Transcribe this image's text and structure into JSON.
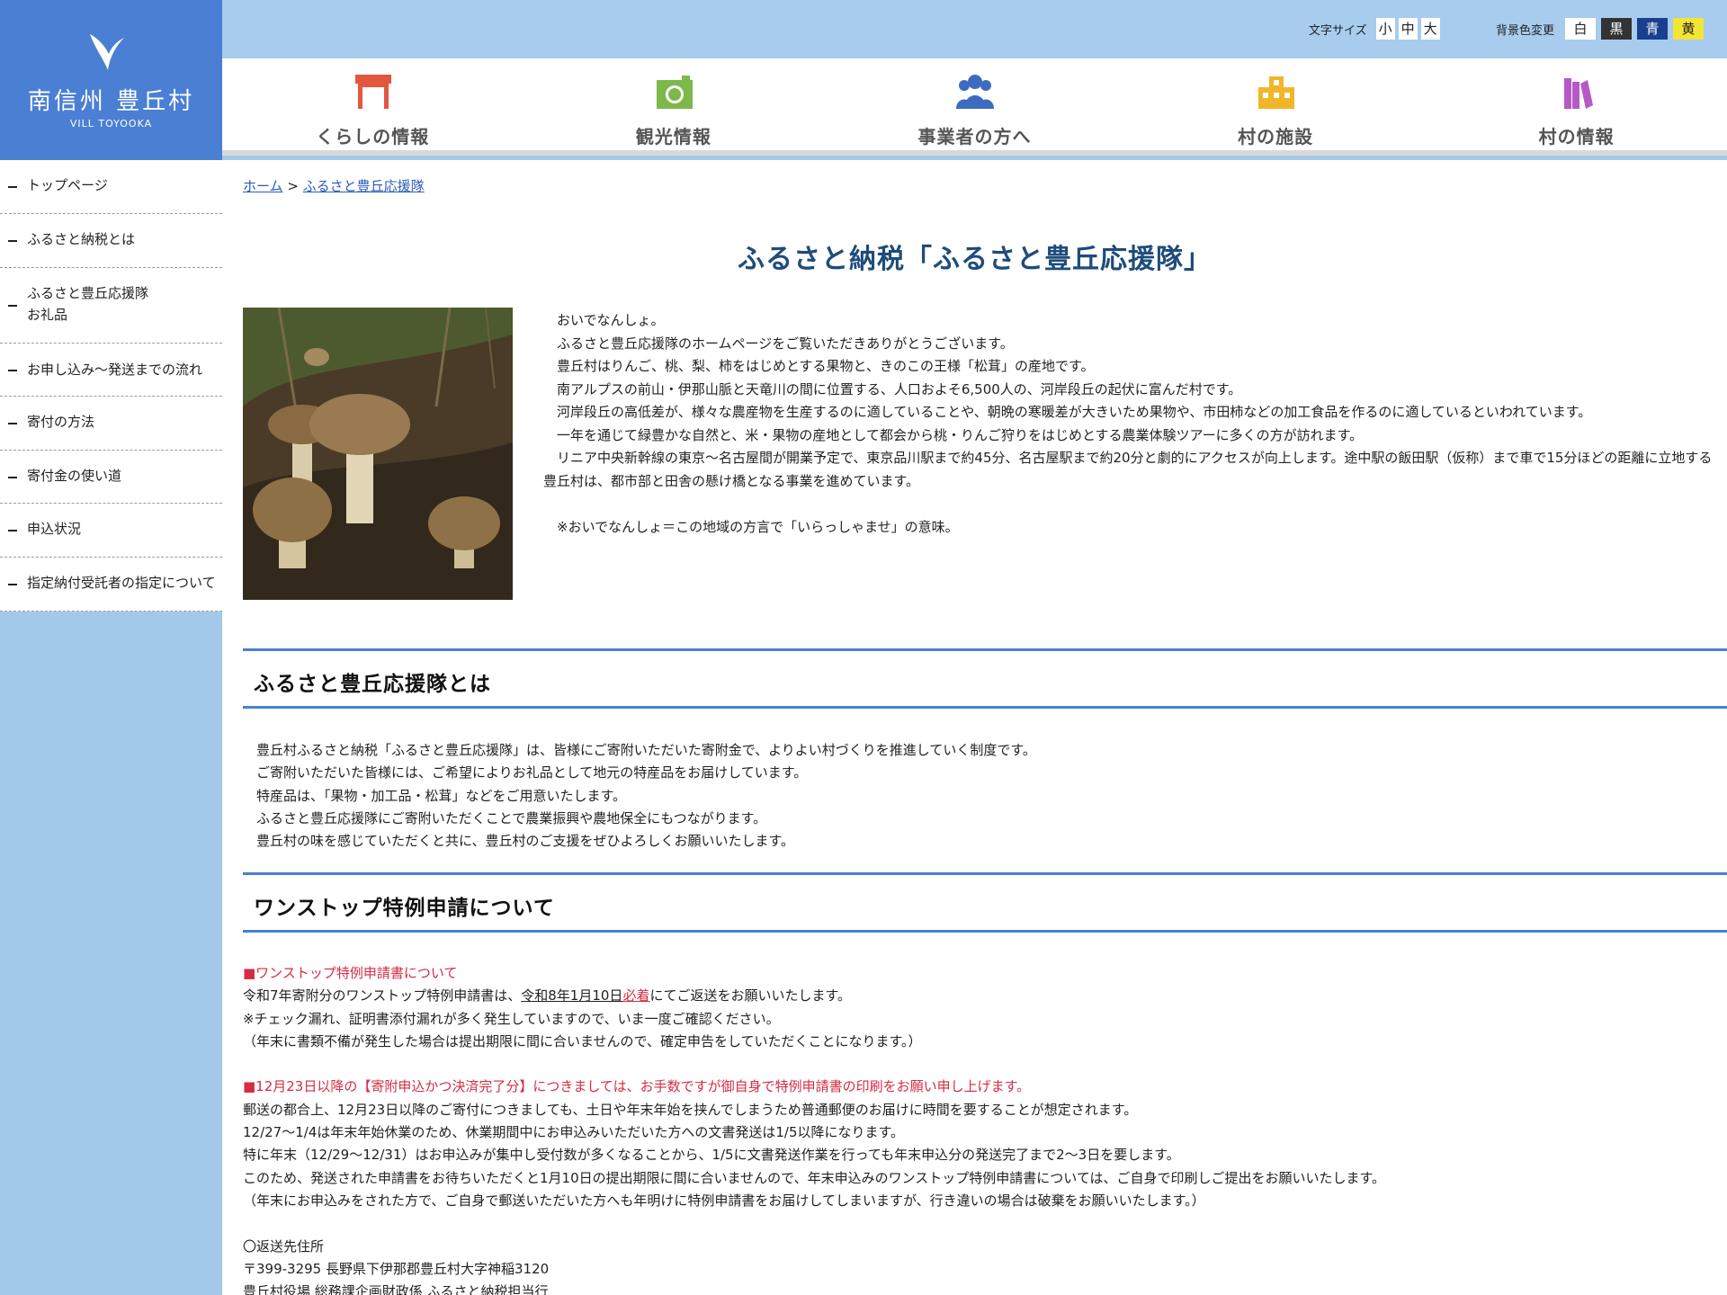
{
  "logo": {
    "name": "南信州 豊丘村",
    "sub": "VILL TOYOOKA"
  },
  "topbar": {
    "fontsize_label": "文字サイズ",
    "fontsize_options": [
      "小",
      "中",
      "大"
    ],
    "bgcolor_label": "背景色変更",
    "bgcolor_options": [
      {
        "label": "白",
        "bg": "#ffffff",
        "fg": "#222222"
      },
      {
        "label": "黒",
        "bg": "#333333",
        "fg": "#ffffff"
      },
      {
        "label": "青",
        "bg": "#1a3f8f",
        "fg": "#ffffff"
      },
      {
        "label": "黄",
        "bg": "#f3e533",
        "fg": "#222222"
      }
    ]
  },
  "nav": [
    {
      "label": "くらしの情報",
      "icon": "house-icon",
      "color": "#e2573e"
    },
    {
      "label": "観光情報",
      "icon": "camera-icon",
      "color": "#7cb84a"
    },
    {
      "label": "事業者の方へ",
      "icon": "people-icon",
      "color": "#3d6cbf"
    },
    {
      "label": "村の施設",
      "icon": "building-icon",
      "color": "#f0b62a"
    },
    {
      "label": "村の情報",
      "icon": "books-icon",
      "color": "#b659c7"
    }
  ],
  "sidebar": {
    "items": [
      {
        "label": "トップページ"
      },
      {
        "label": "ふるさと納税とは"
      },
      {
        "label": "ふるさと豊丘応援隊",
        "label2": "お礼品"
      },
      {
        "label": "お申し込み〜発送までの流れ"
      },
      {
        "label": "寄付の方法"
      },
      {
        "label": "寄付金の使い道"
      },
      {
        "label": "申込状況"
      },
      {
        "label": "指定納付受託者の指定について"
      }
    ]
  },
  "breadcrumb": {
    "home": "ホーム",
    "sep": " > ",
    "current": "ふるさと豊丘応援隊"
  },
  "page_title": "ふるさと納税「ふるさと豊丘応援隊」",
  "intro": [
    "おいでなんしょ。",
    "ふるさと豊丘応援隊のホームページをご覧いただきありがとうございます。",
    "豊丘村はりんご、桃、梨、柿をはじめとする果物と、きのこの王様「松茸」の産地です。",
    "南アルプスの前山・伊那山脈と天竜川の間に位置する、人口およそ6,500人の、河岸段丘の起伏に富んだ村です。",
    "河岸段丘の高低差が、様々な農産物を生産するのに適していることや、朝晩の寒暖差が大きいため果物や、市田柿などの加工食品を作るのに適しているといわれています。",
    "一年を通じて緑豊かな自然と、米・果物の産地として都会から桃・りんご狩りをはじめとする農業体験ツアーに多くの方が訪れます。",
    "リニア中央新幹線の東京〜名古屋間が開業予定で、東京品川駅まで約45分、名古屋駅まで約20分と劇的にアクセスが向上します。途中駅の飯田駅（仮称）まで車で15分ほどの距離に立地する豊丘村は、都市部と田舎の懸け橋となる事業を進めています。",
    "",
    "※おいでなんしょ＝この地域の方言で「いらっしゃませ」の意味。"
  ],
  "about": {
    "heading": "ふるさと豊丘応援隊とは",
    "lines": [
      "豊丘村ふるさと納税「ふるさと豊丘応援隊」は、皆様にご寄附いただいた寄附金で、よりよい村づくりを推進していく制度です。",
      "ご寄附いただいた皆様には、ご希望によりお礼品として地元の特産品をお届けしています。",
      "特産品は、「果物・加工品・松茸」などをご用意いたします。",
      "ふるさと豊丘応援隊にご寄附いただくことで農業振興や農地保全にもつながります。",
      "豊丘村の味を感じていただくと共に、豊丘村のご支援をぜひよろしくお願いいたします。"
    ]
  },
  "onestop": {
    "heading": "ワンストップ特例申請について",
    "sub1": "■ワンストップ特例申請書について",
    "line1_pre": "令和7年寄附分のワンストップ特例申請書は、",
    "line1_date": "令和8年1月10日",
    "line1_must": "必着",
    "line1_post": "にてご返送をお願いいたします。",
    "line2": "※チェック漏れ、証明書添付漏れが多く発生していますので、いま一度ご確認ください。",
    "line3": "（年末に書類不備が発生した場合は提出期限に間に合いませんので、確定申告をしていただくことになります。）",
    "sub2": "■12月23日以降の【寄附申込かつ決済完了分】につきましては、お手数ですが御自身で特例申請書の印刷をお願い申し上げます。",
    "lines2": [
      "郵送の都合上、12月23日以降のご寄付につきましても、土日や年末年始を挟んでしまうため普通郵便のお届けに時間を要することが想定されます。",
      "12/27〜1/4は年末年始休業のため、休業期間中にお申込みいただいた方への文書発送は1/5以降になります。",
      "特に年末（12/29〜12/31）はお申込みが集中し受付数が多くなることから、1/5に文書発送作業を行っても年末申込分の発送完了まで2〜3日を要します。",
      "このため、発送された申請書をお待ちいただくと1月10日の提出期限に間に合いませんので、年末申込みのワンストップ特例申請書については、ご自身で印刷しご提出をお願いいたします。",
      "（年末にお申込みをされた方で、ご自身で郵送いただいた方へも年明けに特例申請書をお届けしてしまいますが、行き違いの場合は破棄をお願いいたします。）"
    ],
    "address_title": "〇返送先住所",
    "address_lines": [
      "〒399-3295 長野県下伊那郡豊丘村大字神稲3120",
      "豊丘村役場 総務課企画財政係 ふるさと納税担当行"
    ]
  }
}
